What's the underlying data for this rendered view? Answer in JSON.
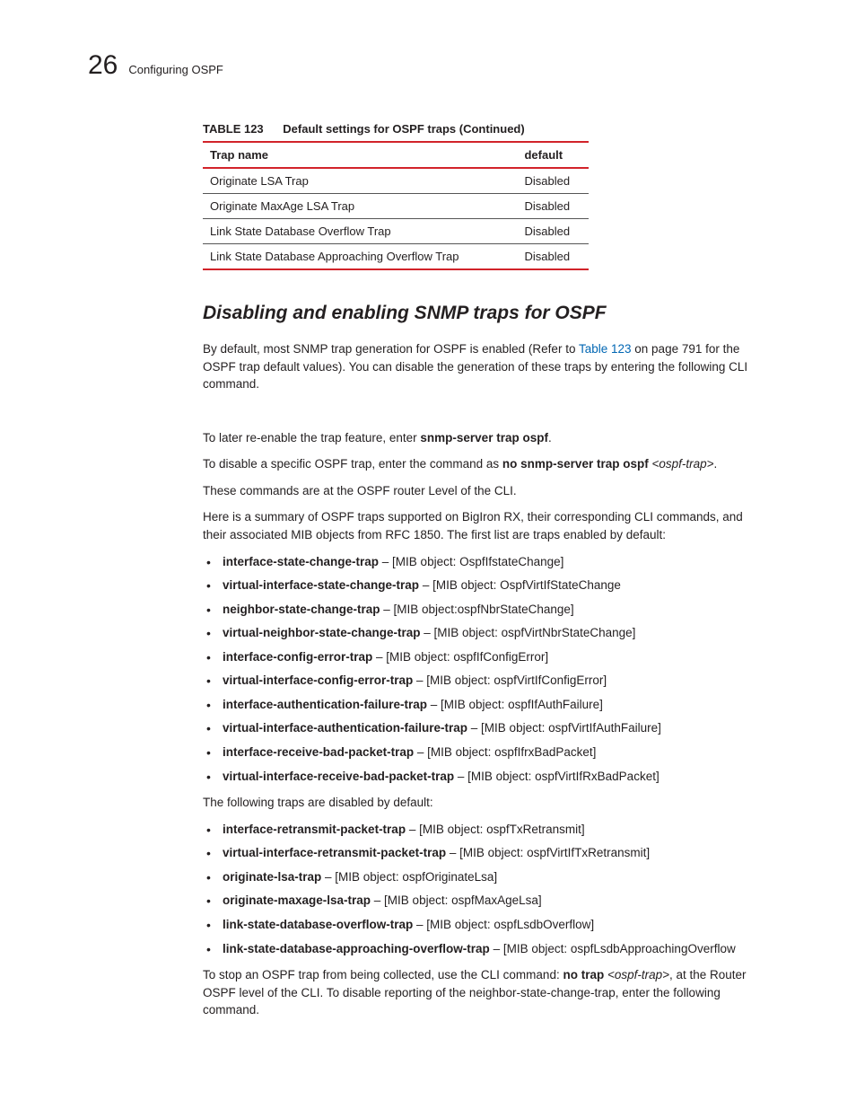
{
  "header": {
    "chapter_number": "26",
    "chapter_title": "Configuring OSPF"
  },
  "table": {
    "label": "TABLE 123",
    "title": "Default settings for OSPF traps (Continued)",
    "col1": "Trap name",
    "col2": "default",
    "rows": [
      {
        "name": "Originate LSA Trap",
        "def": "Disabled"
      },
      {
        "name": "Originate MaxAge LSA Trap",
        "def": "Disabled"
      },
      {
        "name": "Link State Database Overflow Trap",
        "def": "Disabled"
      },
      {
        "name": "Link State Database Approaching Overflow Trap",
        "def": "Disabled"
      }
    ]
  },
  "section_heading": "Disabling and enabling SNMP traps for OSPF",
  "para1": {
    "a": "By default, most SNMP trap generation for OSPF is enabled (Refer to ",
    "link": "Table 123",
    "b": " on page 791 for the OSPF trap default values). You can disable the generation of these traps by entering the following CLI command."
  },
  "para2": {
    "a": "To later re-enable the trap feature, enter ",
    "b": "snmp-server trap ospf",
    "c": "."
  },
  "para3": {
    "a": "To disable a specific OSPF trap, enter the command as ",
    "b": "no snmp-server trap ospf ",
    "c": "<ospf-trap>",
    "d": "."
  },
  "para4": "These commands are at the OSPF router Level of the CLI.",
  "para5": "Here is a summary of OSPF traps supported on BigIron RX, their corresponding CLI commands, and their associated MIB objects from RFC 1850. The first list are traps enabled by default:",
  "enabled": [
    {
      "cmd": "interface-state-change-trap",
      "rest": " – [MIB object: OspfIfstateChange]"
    },
    {
      "cmd": "virtual-interface-state-change-trap",
      "rest": " – [MIB object: OspfVirtIfStateChange"
    },
    {
      "cmd": "neighbor-state-change-trap",
      "rest": " – [MIB object:ospfNbrStateChange]"
    },
    {
      "cmd": "virtual-neighbor-state-change-trap",
      "rest": " – [MIB object: ospfVirtNbrStateChange]"
    },
    {
      "cmd": "interface-config-error-trap",
      "rest": " – [MIB object: ospfIfConfigError]"
    },
    {
      "cmd": "virtual-interface-config-error-trap",
      "rest": " – [MIB object: ospfVirtIfConfigError]"
    },
    {
      "cmd": "interface-authentication-failure-trap",
      "rest": " – [MIB object: ospfIfAuthFailure]"
    },
    {
      "cmd": "virtual-interface-authentication-failure-trap",
      "rest": " – [MIB object: ospfVirtIfAuthFailure]"
    },
    {
      "cmd": "interface-receive-bad-packet-trap",
      "rest": " – [MIB object: ospfIfrxBadPacket]"
    },
    {
      "cmd": "virtual-interface-receive-bad-packet-trap",
      "rest": " – [MIB object: ospfVirtIfRxBadPacket]"
    }
  ],
  "para6": "The following traps are disabled by default:",
  "disabled": [
    {
      "cmd": "interface-retransmit-packet-trap",
      "rest": " – [MIB object: ospfTxRetransmit]"
    },
    {
      "cmd": "virtual-interface-retransmit-packet-trap",
      "rest": " – [MIB object: ospfVirtIfTxRetransmit]"
    },
    {
      "cmd": "originate-lsa-trap",
      "rest": " – [MIB object: ospfOriginateLsa]"
    },
    {
      "cmd": "originate-maxage-lsa-trap",
      "rest": " – [MIB object: ospfMaxAgeLsa]"
    },
    {
      "cmd": "link-state-database-overflow-trap",
      "rest": " – [MIB object: ospfLsdbOverflow]"
    },
    {
      "cmd": "link-state-database-approaching-overflow-trap",
      "rest": " – [MIB object: ospfLsdbApproachingOverflow"
    }
  ],
  "para7": {
    "a": "To stop an OSPF trap from being collected, use the CLI command: ",
    "b": "no trap ",
    "c": "<ospf-trap>",
    "d": ", at the Router OSPF level of the CLI. To disable reporting of the neighbor-state-change-trap, enter the following command."
  }
}
